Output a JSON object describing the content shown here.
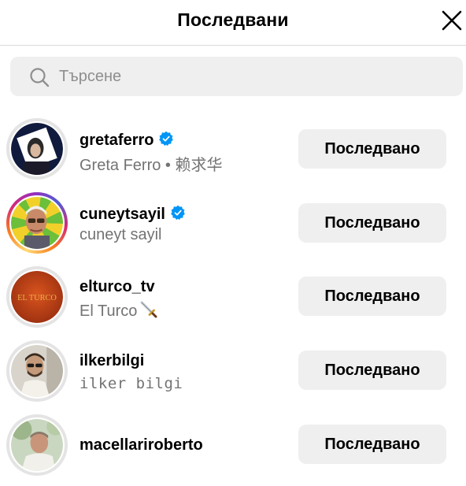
{
  "header": {
    "title": "Последвани"
  },
  "search": {
    "placeholder": "Търсене"
  },
  "follow_label": "Последвано",
  "users": [
    {
      "username": "gretaferro",
      "full_name": "Greta Ferro • 赖求华",
      "verified": true,
      "story_ring": false,
      "avatar_icon": "portrait-photo"
    },
    {
      "username": "cuneytsayil",
      "full_name": "cuneyt sayil",
      "verified": true,
      "story_ring": true,
      "avatar_icon": "portrait-photo"
    },
    {
      "username": "elturco_tv",
      "full_name": "El Turco",
      "full_name_emoji": "dagger-icon",
      "verified": false,
      "story_ring": false,
      "avatar_text": "EL TURCO",
      "avatar_color": "#c1441a"
    },
    {
      "username": "ilkerbilgi",
      "full_name": "ilker bilgi",
      "verified": false,
      "story_ring": false,
      "avatar_icon": "portrait-photo"
    },
    {
      "username": "macellariroberto",
      "full_name": "",
      "verified": false,
      "story_ring": false,
      "avatar_icon": "portrait-photo"
    }
  ],
  "colors": {
    "verified_badge": "#0095f6",
    "button_bg": "#efefef",
    "secondary_text": "#737373"
  }
}
